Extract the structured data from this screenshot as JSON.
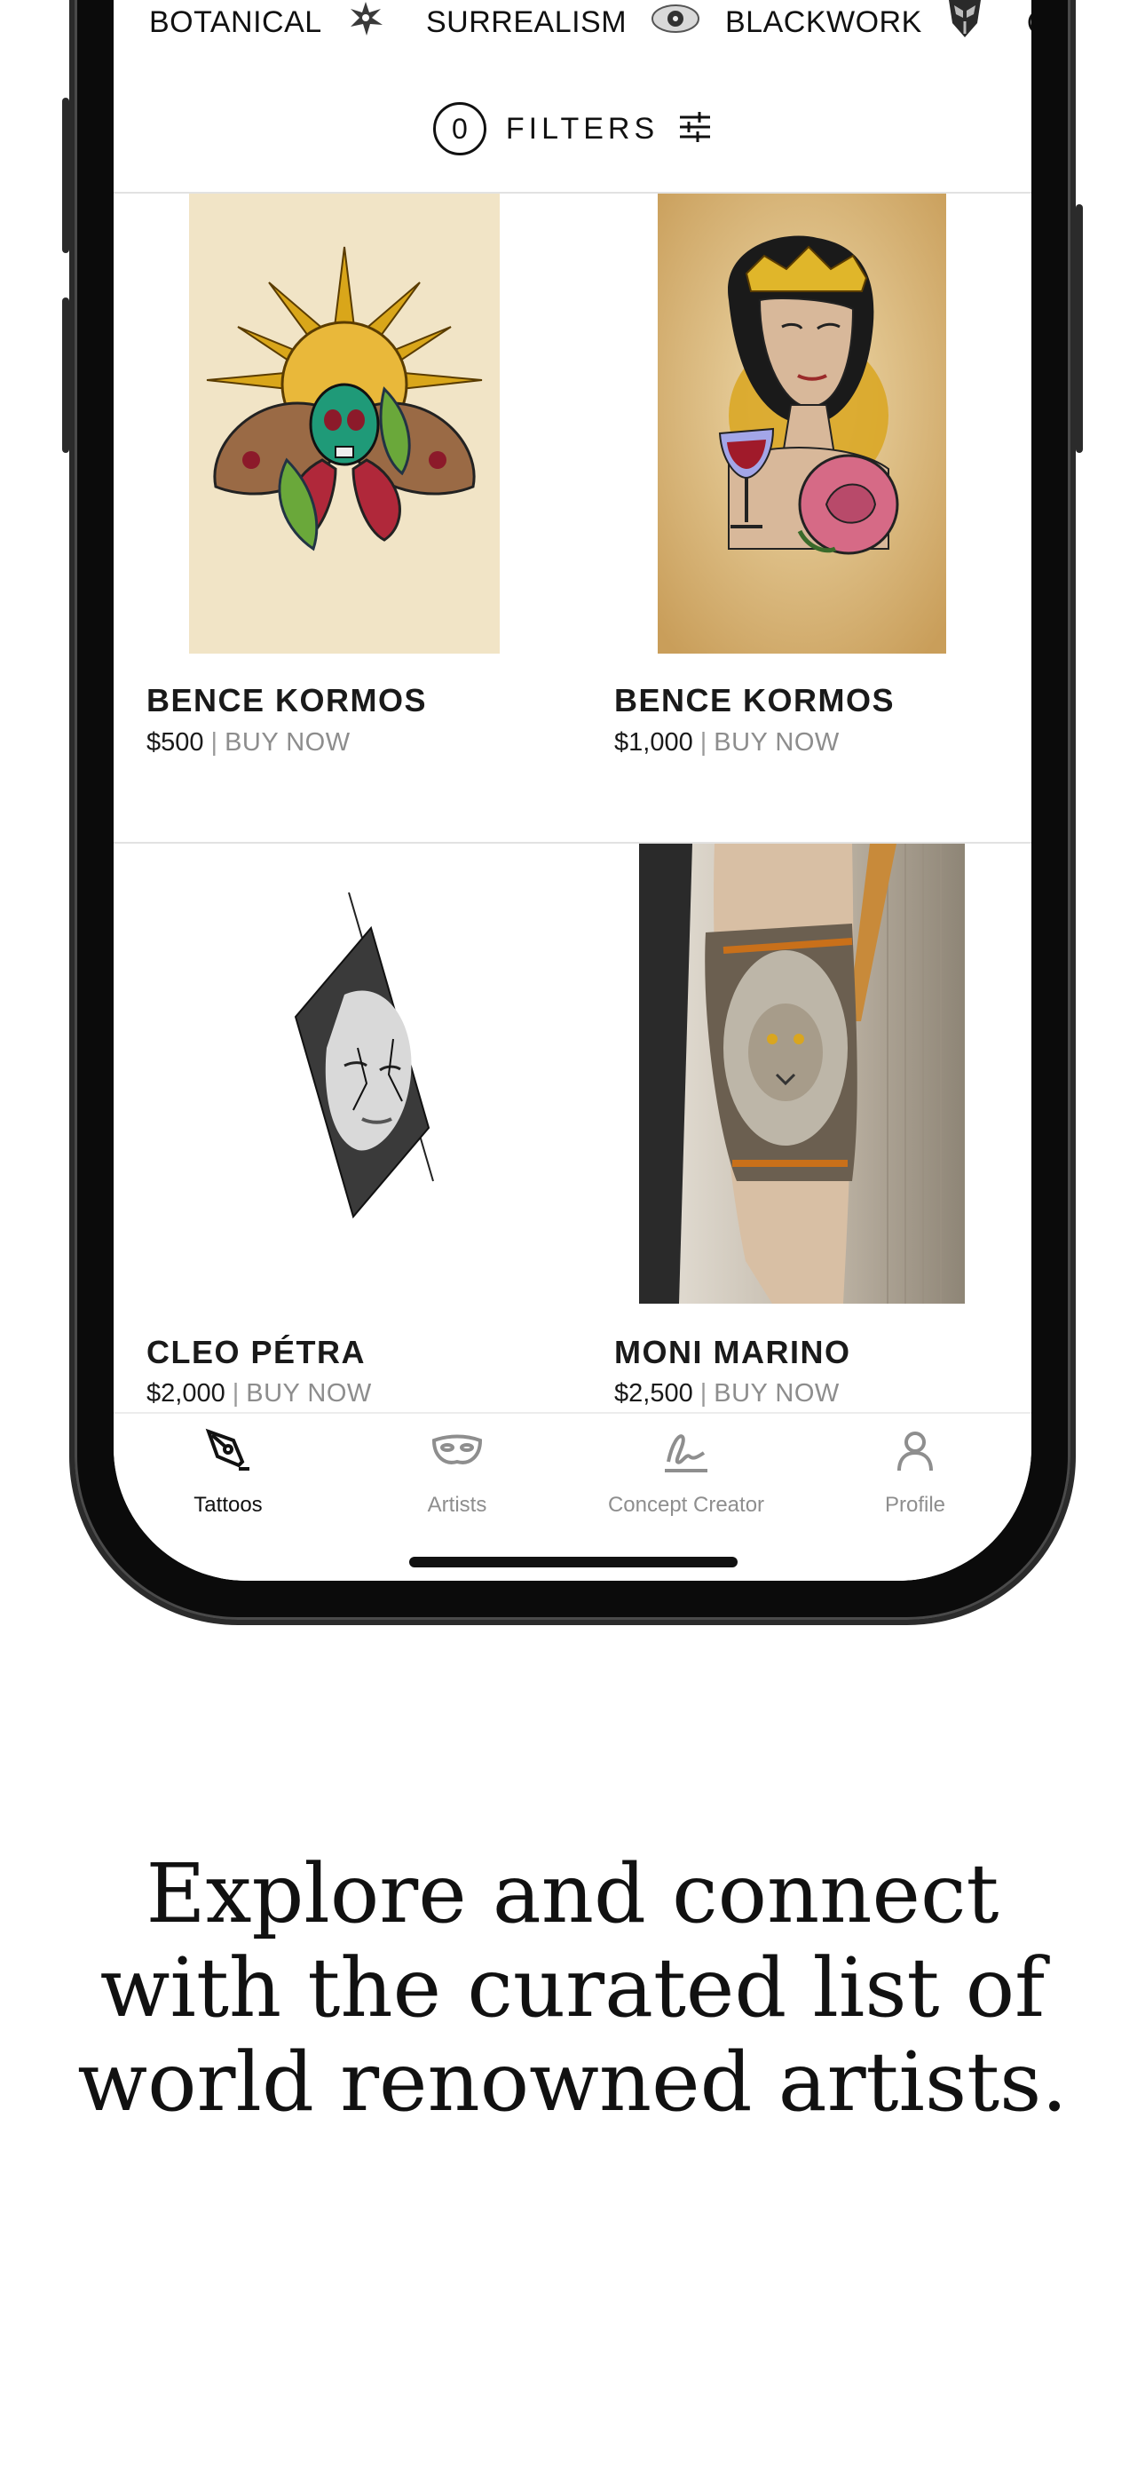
{
  "categories": [
    {
      "label": "BOTANICAL",
      "icon": "botanical-flower-icon"
    },
    {
      "label": "SURREALISM",
      "icon": "surrealism-eye-icon"
    },
    {
      "label": "BLACKWORK",
      "icon": "blackwork-mask-icon"
    }
  ],
  "filters": {
    "count": "0",
    "label": "FILTERS",
    "icon": "sliders-icon"
  },
  "cards": [
    {
      "artist": "BENCE KORMOS",
      "price": "$500",
      "action": "BUY NOW",
      "image": "moth-skull-sun-tattoo-design"
    },
    {
      "artist": "BENCE KORMOS",
      "price": "$1,000",
      "action": "BUY NOW",
      "image": "woman-rose-wine-glass-tattoo-design"
    },
    {
      "artist": "CLEO PÉTRA",
      "price": "$2,000",
      "action": "BUY NOW",
      "image": "portrait-woman-blackwork-tattoo-design"
    },
    {
      "artist": "MONI MARINO",
      "price": "$2,500",
      "action": "BUY NOW",
      "image": "lion-forearm-tattoo-photo"
    }
  ],
  "tabs": [
    {
      "label": "Tattoos",
      "icon": "tattoo-pen-icon",
      "active": true
    },
    {
      "label": "Artists",
      "icon": "artist-mask-icon",
      "active": false
    },
    {
      "label": "Concept Creator",
      "icon": "signature-pen-icon",
      "active": false
    },
    {
      "label": "Profile",
      "icon": "profile-person-icon",
      "active": false
    }
  ],
  "tagline": {
    "line1": "Explore and connect",
    "line2": "with the curated list of",
    "line3": "world renowned artists."
  },
  "colors": {
    "accent": "#111111",
    "muted": "#8e8e8e",
    "divider": "#e2e2e2"
  }
}
